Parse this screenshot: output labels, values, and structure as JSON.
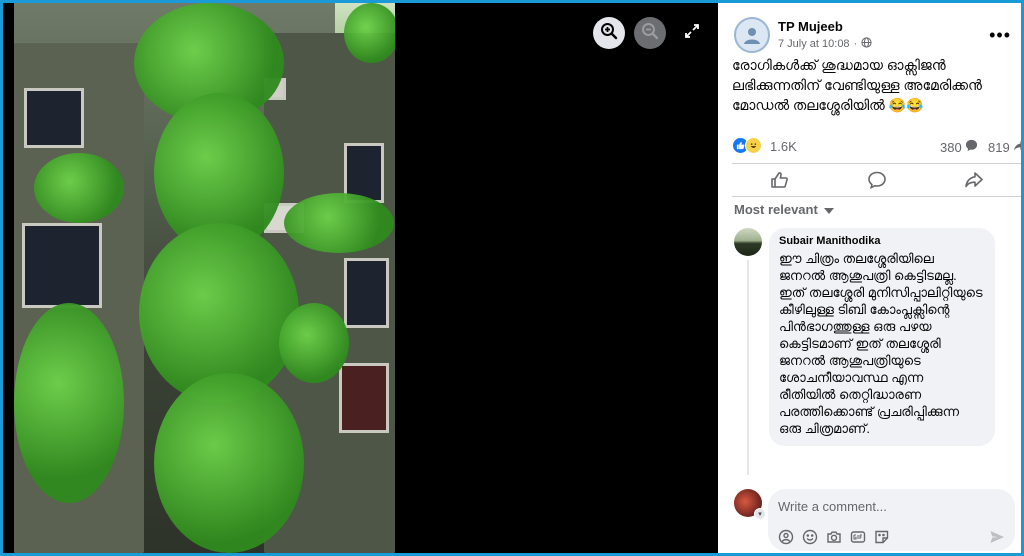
{
  "viewer": {
    "buttons": {
      "zoom_in": "zoom-in-icon",
      "zoom_out": "zoom-out-icon",
      "fullscreen": "fullscreen-icon"
    }
  },
  "post": {
    "author": "TP Mujeeb",
    "timestamp": "7 July at 10:08",
    "separator": "·",
    "caption": "രോഗികൾക്ക് ശുദ്ധമായ ഓക്സിജൻ ലഭിക്കുന്നതിന് വേണ്ടിയുള്ള അമേരിക്കൻ മോഡൽ തലശ്ശേരിയിൽ 😂😂"
  },
  "stats": {
    "reactions": "1.6K",
    "comments": "380",
    "shares": "819"
  },
  "sort": {
    "label": "Most relevant"
  },
  "comment": {
    "author": "Subair Manithodika",
    "text": "ഈ ചിത്രം തലശ്ശേരിയിലെ ജനറൽ ആശുപത്രി കെട്ടിടമല്ല. ഇത് തലശ്ശേരി മുനിസിപ്പാലിറ്റിയുടെ കീഴിലുള്ള ടിബി കോംപ്ലക്സിന്റെ പിൻഭാഗത്തുള്ള ഒരു പഴയ കെട്ടിടമാണ് ഇത് തലശ്ശേരി ജനറൽ ആശുപത്രിയുടെ ശോചനീയാവസ്ഥ എന്ന രീതിയിൽ തെറ്റിദ്ധാരണ പരത്തിക്കൊണ്ട് പ്രചരിപ്പിക്കുന്ന ഒരു ചിത്രമാണ്."
  },
  "composer": {
    "placeholder": "Write a comment..."
  },
  "colors": {
    "accent": "#1877f2",
    "frame": "#1a9ad6"
  }
}
